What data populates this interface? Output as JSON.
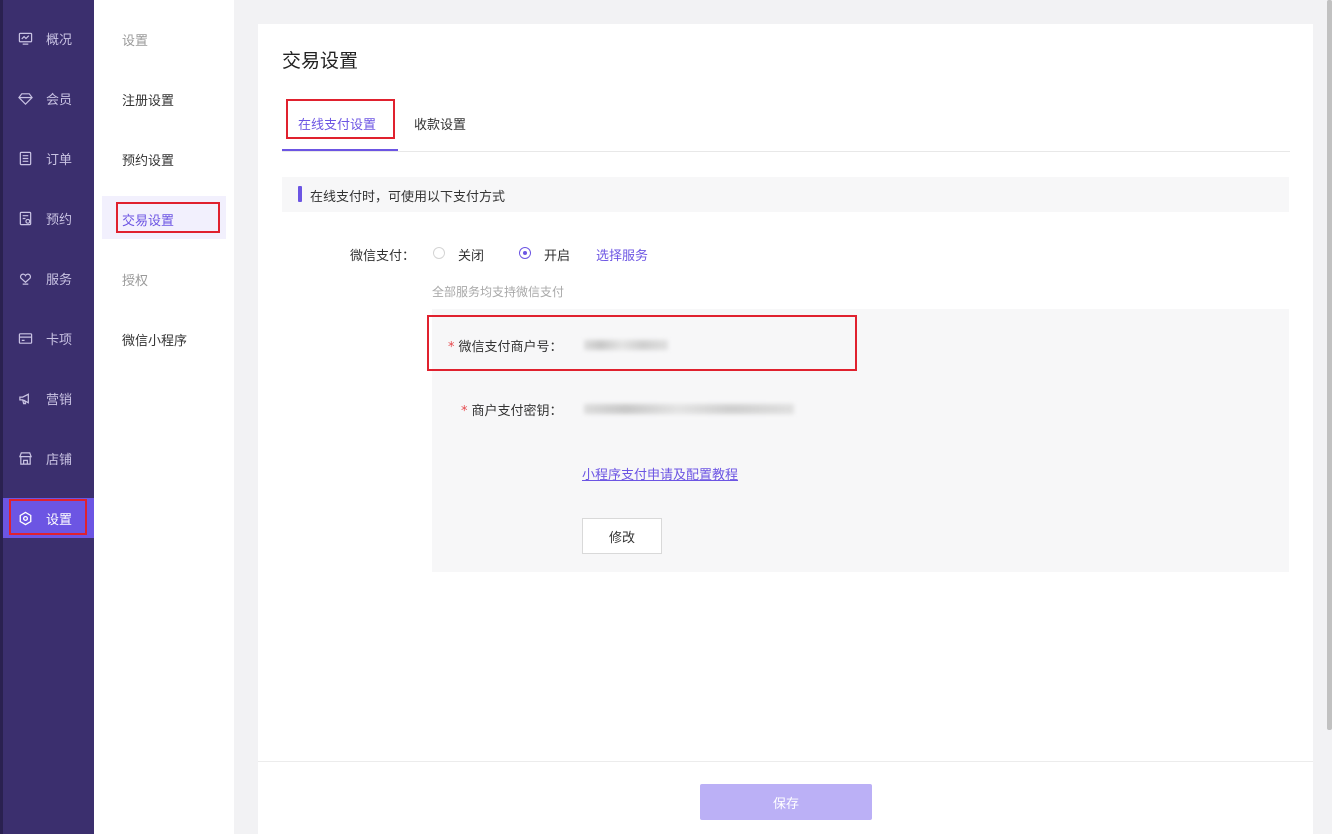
{
  "sidebar": {
    "items": [
      {
        "label": "概况",
        "icon": "monitor-icon"
      },
      {
        "label": "会员",
        "icon": "diamond-icon"
      },
      {
        "label": "订单",
        "icon": "list-icon"
      },
      {
        "label": "预约",
        "icon": "calendar-icon"
      },
      {
        "label": "服务",
        "icon": "heart-hand-icon"
      },
      {
        "label": "卡项",
        "icon": "card-icon"
      },
      {
        "label": "营销",
        "icon": "megaphone-icon"
      },
      {
        "label": "店铺",
        "icon": "store-icon"
      },
      {
        "label": "设置",
        "icon": "settings-icon",
        "active": true
      }
    ]
  },
  "submenu": {
    "items": [
      {
        "label": "设置"
      },
      {
        "label": "注册设置"
      },
      {
        "label": "预约设置"
      },
      {
        "label": "交易设置"
      },
      {
        "label": "授权"
      },
      {
        "label": "微信小程序"
      }
    ]
  },
  "page": {
    "title": "交易设置",
    "tabs": [
      {
        "label": "在线支付设置"
      },
      {
        "label": "收款设置"
      }
    ],
    "notice": "在线支付时，可使用以下支付方式",
    "wechat_pay": {
      "label": "微信支付：",
      "option_off": "关闭",
      "option_on": "开启",
      "selected": "开启",
      "select_service": "选择服务",
      "hint": "全部服务均支持微信支付"
    },
    "merchant_id_label": "微信支付商户号：",
    "merchant_key_label": "商户支付密钥：",
    "tutorial_link": "小程序支付申请及配置教程",
    "edit_button": "修改",
    "save_button": "保存"
  },
  "colors": {
    "sidebar_bg": "#3b2f6e",
    "accent": "#6c55e3",
    "highlight_box": "#e0212e",
    "save_button_bg": "#bbb0f6"
  }
}
